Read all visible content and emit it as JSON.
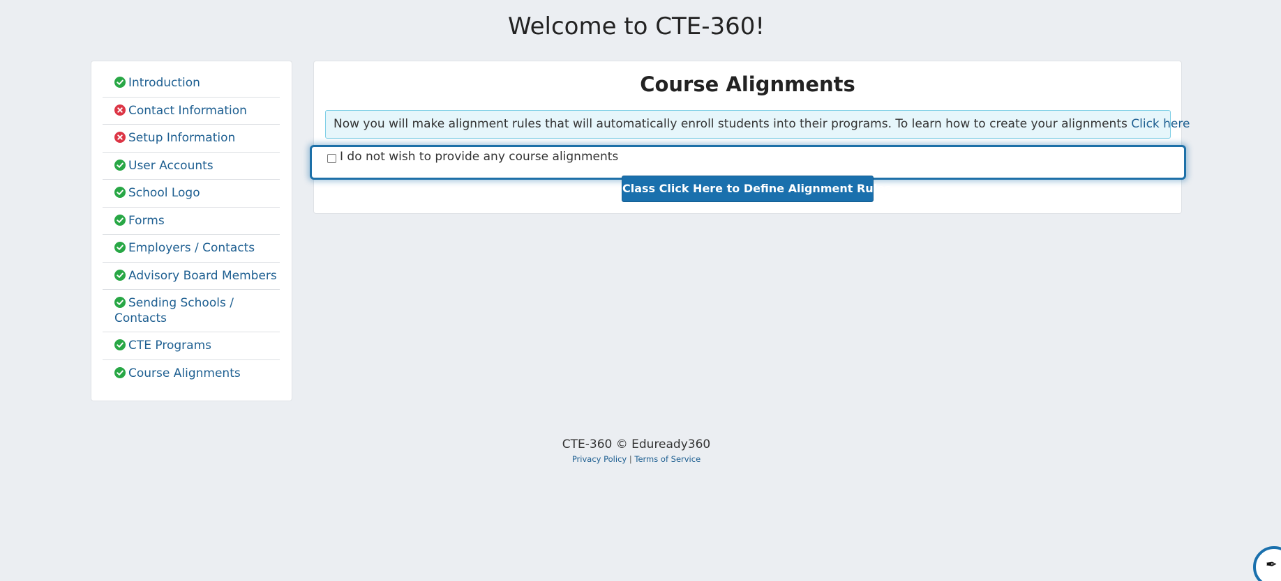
{
  "header": {
    "title": "Welcome to CTE-360!"
  },
  "sidebar": {
    "items": [
      {
        "label": "Introduction",
        "status": "complete"
      },
      {
        "label": "Contact Information",
        "status": "incomplete"
      },
      {
        "label": "Setup Information",
        "status": "incomplete"
      },
      {
        "label": "User Accounts",
        "status": "complete"
      },
      {
        "label": "School Logo",
        "status": "complete"
      },
      {
        "label": "Forms",
        "status": "complete"
      },
      {
        "label": "Employers / Contacts",
        "status": "complete"
      },
      {
        "label": "Advisory Board Members",
        "status": "complete"
      },
      {
        "label": "Sending Schools / Contacts",
        "status": "complete"
      },
      {
        "label": "CTE Programs",
        "status": "complete"
      },
      {
        "label": "Course Alignments",
        "status": "complete"
      }
    ]
  },
  "main": {
    "title": "Course Alignments",
    "info_text": "Now you will make alignment rules that will automatically enroll students into their programs. To learn how to create your alignments ",
    "info_link": "Click here",
    "optout_label": "I do not wish to provide any course alignments",
    "optout_checked": false,
    "define_button": "Class Click Here to Define Alignment Rules"
  },
  "footer": {
    "copyright": "CTE-360 © Eduready360",
    "privacy": "Privacy Policy",
    "separator": " | ",
    "terms": "Terms of Service"
  },
  "colors": {
    "complete": "#28a745",
    "incomplete": "#dc3545",
    "link": "#1e5f91",
    "primary": "#1a70ad"
  }
}
